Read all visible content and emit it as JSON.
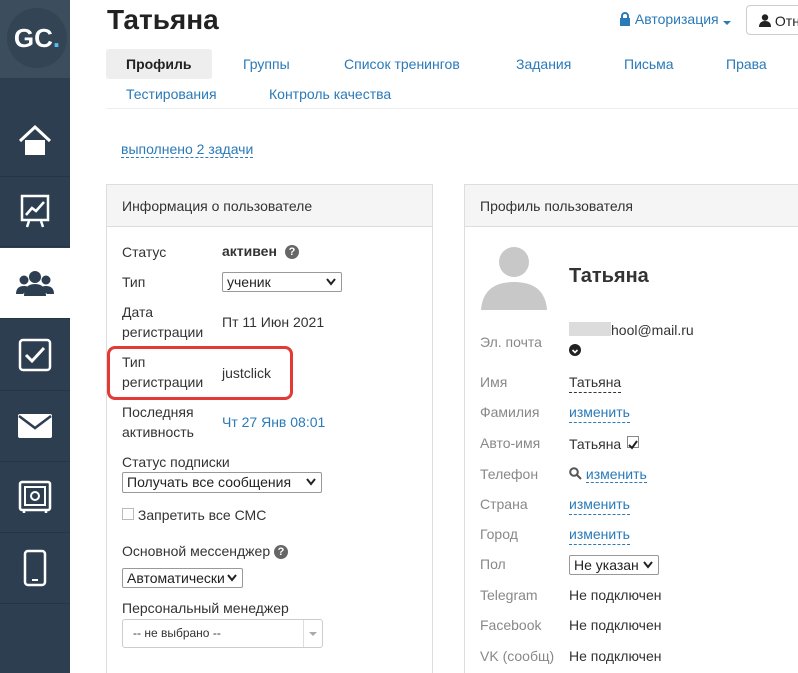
{
  "logo": {
    "text": "GC",
    "dot": "."
  },
  "nav": [
    {
      "name": "home"
    },
    {
      "name": "analytics"
    },
    {
      "name": "users"
    },
    {
      "name": "tasks"
    },
    {
      "name": "mail"
    },
    {
      "name": "safe"
    },
    {
      "name": "mobile"
    }
  ],
  "header": {
    "title": "Татьяна",
    "auth_label": "Авторизация",
    "other_label": "Отн"
  },
  "tabs": [
    {
      "label": "Профиль",
      "active": true
    },
    {
      "label": "Группы"
    },
    {
      "label": "Список тренингов"
    },
    {
      "label": "Задания"
    },
    {
      "label": "Письма"
    },
    {
      "label": "Права"
    },
    {
      "label": "Тестирования"
    },
    {
      "label": "Контроль качества"
    }
  ],
  "tasks_link": "выполнено 2 задачи",
  "user_info": {
    "title": "Информация о пользователе",
    "status_label": "Статус",
    "status_value": "активен",
    "type_label": "Тип",
    "type_value": "ученик",
    "reg_date_label": "Дата регистрации",
    "reg_date_value": "Пт 11 Июн 2021",
    "reg_type_label": "Тип регистрации",
    "reg_type_value": "justclick",
    "last_activity_label": "Последняя активность",
    "last_activity_value": "Чт 27 Янв 08:01",
    "subscription_label": "Статус подписки",
    "subscription_value": "Получать все сообщения",
    "block_sms_label": "Запретить все СМС",
    "messenger_label": "Основной мессенджер",
    "messenger_value": "Автоматически",
    "manager_label": "Персональный менеджер",
    "manager_value": "-- не выбрано --"
  },
  "profile": {
    "title": "Профиль пользователя",
    "name": "Татьяна",
    "email_label": "Эл. почта",
    "email_value": "hool@mail.ru",
    "first_name_label": "Имя",
    "first_name_value": "Татьяна",
    "last_name_label": "Фамилия",
    "last_name_value": "изменить",
    "auto_name_label": "Авто-имя",
    "auto_name_value": "Татьяна",
    "phone_label": "Телефон",
    "phone_value": "изменить",
    "country_label": "Страна",
    "country_value": "изменить",
    "city_label": "Город",
    "city_value": "изменить",
    "gender_label": "Пол",
    "gender_value": "Не указан",
    "telegram_label": "Telegram",
    "telegram_value": "Не подключен",
    "facebook_label": "Facebook",
    "facebook_value": "Не подключен",
    "vk_label": "VK (сообщ)",
    "vk_value": "Не подключен"
  },
  "colors": {
    "accent": "#2a7ab8",
    "sidebar": "#2d3e50",
    "highlight": "#e53935"
  }
}
